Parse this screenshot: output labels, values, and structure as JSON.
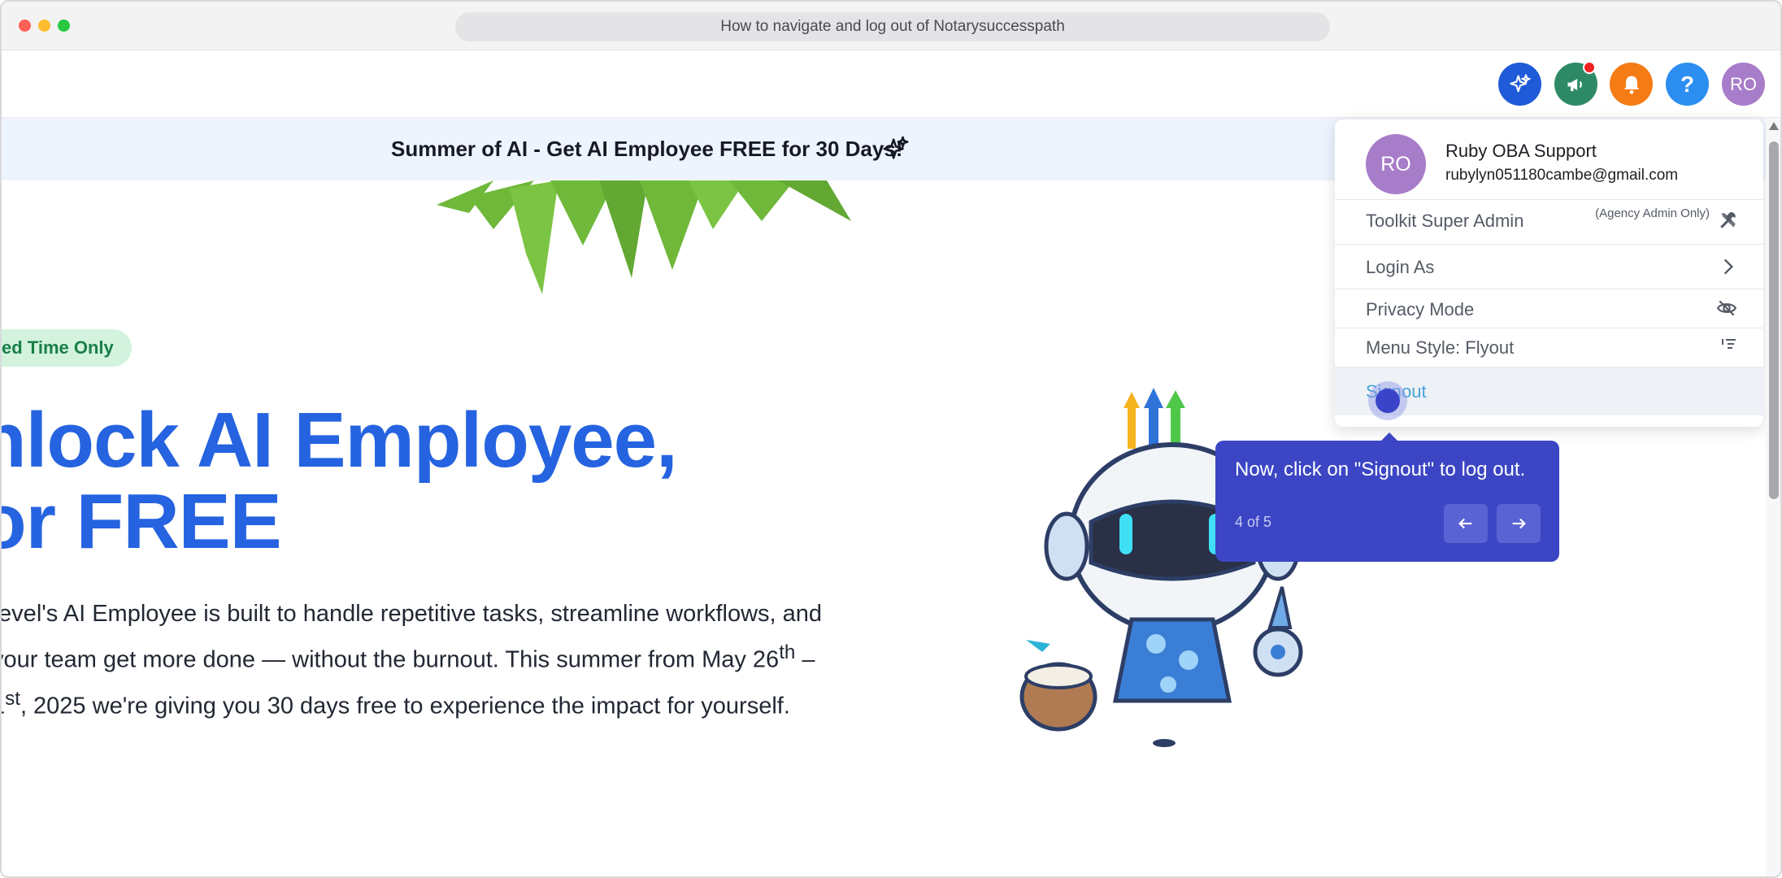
{
  "browser": {
    "title": "How to navigate and log out of Notarysuccesspath"
  },
  "topnav": {
    "help_label": "?",
    "avatar_initials": "RO",
    "icons": [
      "ai-sparkle-icon",
      "megaphone-icon",
      "bell-icon",
      "help-icon"
    ]
  },
  "banner": {
    "text": "Summer of AI - Get AI Employee FREE for 30 Days!"
  },
  "hero": {
    "badge": "ed Time Only",
    "headline_line1": "nlock AI Employee,",
    "headline_line2": "or FREE",
    "para_line1": ".evel's AI Employee is built to handle repetitive tasks, streamline workflows, and",
    "para_line2_pre": "your team get more done — without the burnout. This summer from May 26",
    "para_line2_sup": "th",
    "para_line2_post": " –",
    "para_line3_pre": "1",
    "para_line3_sup": "st",
    "para_line3_post": ", 2025 we're giving you 30 days free to experience the impact for yourself."
  },
  "dropdown": {
    "avatar_initials": "RO",
    "name": "Ruby OBA Support",
    "email": "rubylyn051180cambe@gmail.com",
    "items": [
      {
        "label": "Toolkit Super Admin",
        "note": "(Agency Admin Only)",
        "icon": "tools-icon"
      },
      {
        "label": "Login As",
        "icon": "chevron-right-icon"
      },
      {
        "label": "Privacy Mode",
        "icon": "eye-slash-icon"
      },
      {
        "label": "Menu Style: Flyout",
        "icon": "menu-style-icon"
      },
      {
        "label": "Signout"
      }
    ]
  },
  "tooltip": {
    "text": "Now, click on \"Signout\" to log out.",
    "step": "4 of 5"
  },
  "colors": {
    "accent": "#2563e0",
    "tooltip": "#3c46c4",
    "banner_bg": "#eef4fe"
  }
}
